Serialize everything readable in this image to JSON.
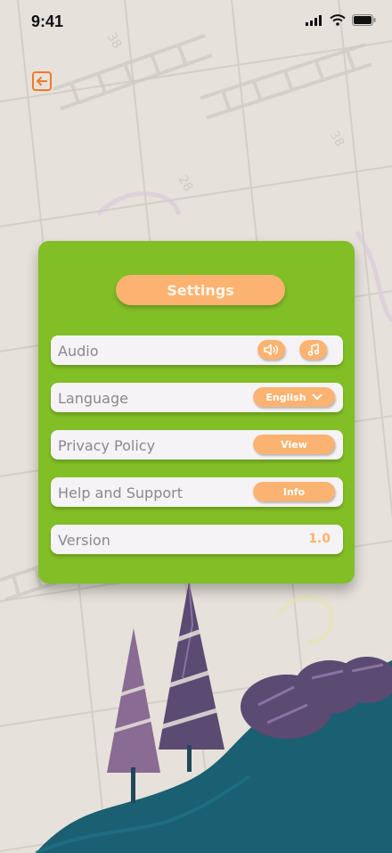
{
  "status_bar": {
    "time": "9:41",
    "icons": [
      "signal-icon",
      "wifi-icon",
      "battery-icon"
    ]
  },
  "back_button": {
    "icon": "arrow-left-icon",
    "color": "#f07a26"
  },
  "settings": {
    "title": "Settings",
    "rows": {
      "audio": {
        "label": "Audio",
        "buttons": [
          "speaker-icon",
          "music-note-icon"
        ]
      },
      "language": {
        "label": "Language",
        "value": "English",
        "icon": "chevron-down-icon"
      },
      "privacy": {
        "label": "Privacy Policy",
        "button": "View"
      },
      "help": {
        "label": "Help and Support",
        "button": "Info"
      },
      "version": {
        "label": "Version",
        "value": "1.0"
      }
    }
  },
  "colors": {
    "panel": "#82be26",
    "accent": "#fcb371",
    "row_background": "#f5f3f5",
    "background": "#e6e1da"
  }
}
